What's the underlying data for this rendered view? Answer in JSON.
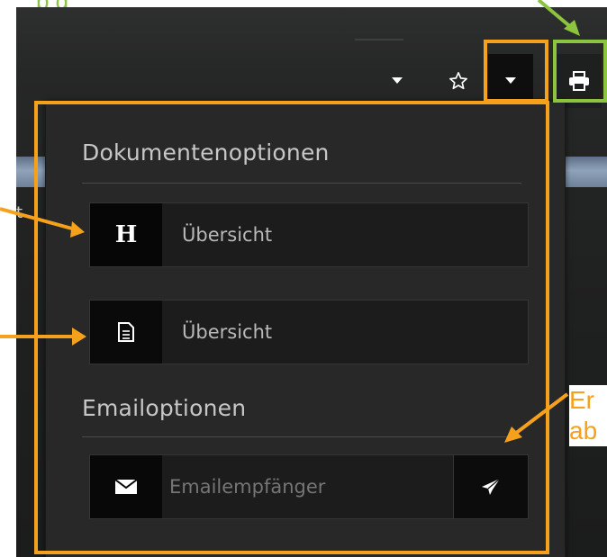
{
  "annotations": {
    "top_green_text": "p        g",
    "callout_line1": "Er",
    "callout_line2": "ab",
    "left_cut_label": "t"
  },
  "toolbar": {
    "dropdown_a_icon": "caret-down-icon",
    "star_icon": "star-outline-icon",
    "dropdown_b_icon": "caret-down-icon",
    "print_icon": "printer-icon"
  },
  "dropdown": {
    "document_section_title": "Dokumentenoptionen",
    "document_rows": [
      {
        "icon": "heading-icon",
        "icon_text": "H",
        "label": "Übersicht"
      },
      {
        "icon": "document-icon",
        "label": "Übersicht"
      }
    ],
    "email_section_title": "Emailoptionen",
    "email": {
      "icon": "envelope-icon",
      "placeholder": "Emailempfänger",
      "send_icon": "paper-plane-icon"
    }
  },
  "colors": {
    "highlight_orange": "#f6a11b",
    "highlight_green": "#8cc43f",
    "panel_bg": "#282828",
    "icon_box_bg": "#060606"
  }
}
